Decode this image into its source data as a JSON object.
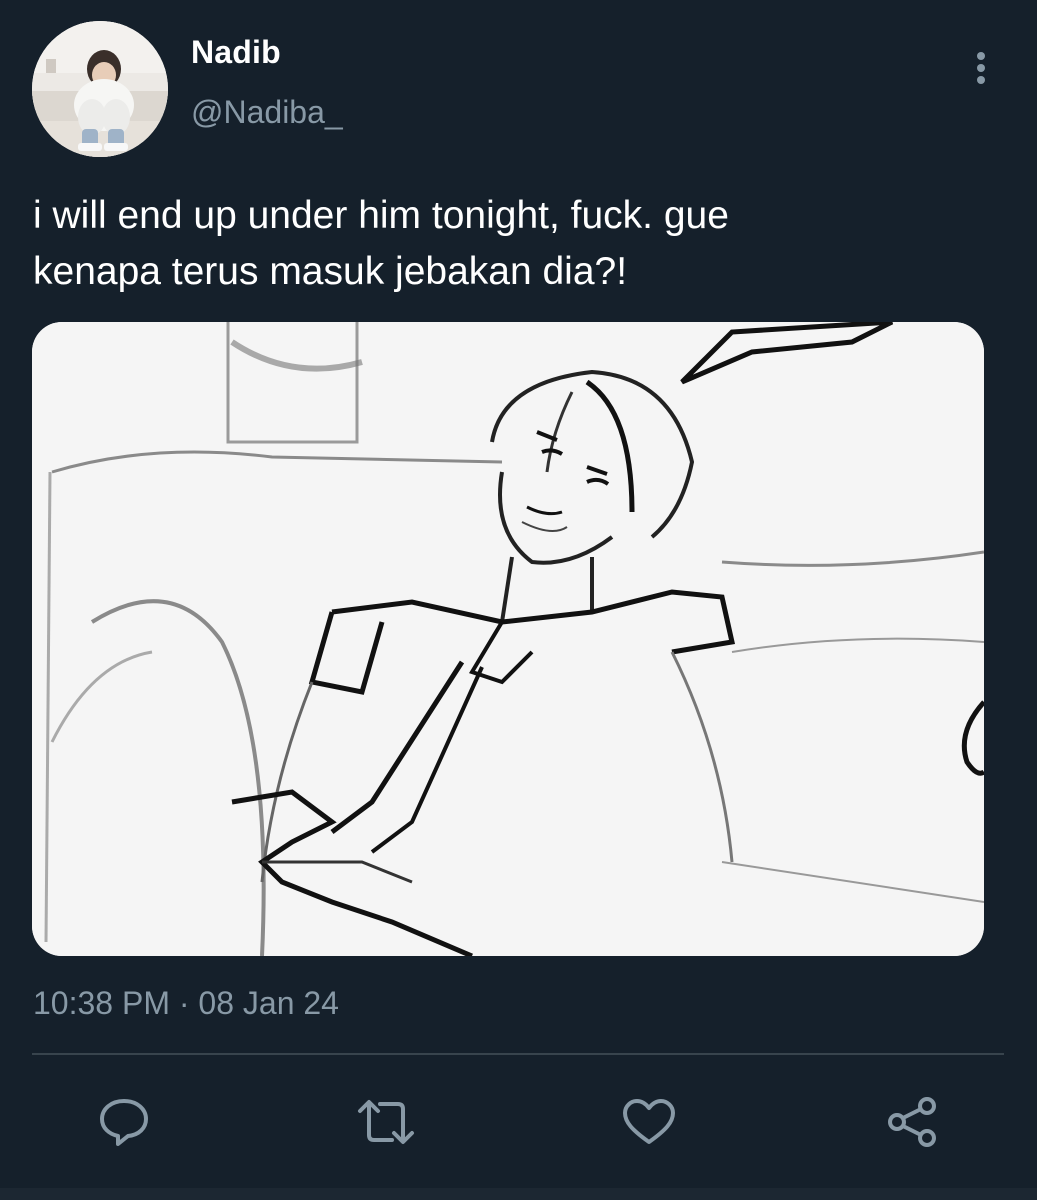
{
  "tweet": {
    "display_name": "Nadib",
    "handle": "@Nadiba_",
    "text": "i will end up under him tonight, fuck. gue\nkenapa terus masuk jebakan dia?!",
    "timestamp": "10:38 PM · 08 Jan 24"
  },
  "icons": {
    "more": "more-vertical-icon",
    "reply": "reply-icon",
    "retweet": "retweet-icon",
    "like": "heart-icon",
    "share": "share-icon"
  },
  "colors": {
    "background": "#15202b",
    "secondary_text": "#8899a6",
    "divider": "#38444d",
    "primary_text": "#ffffff"
  }
}
